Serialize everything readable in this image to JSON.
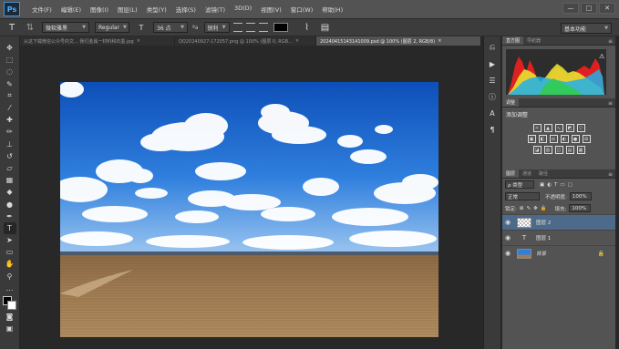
{
  "app": {
    "logo": "Ps"
  },
  "menu": [
    "文件(F)",
    "编辑(E)",
    "图像(I)",
    "图层(L)",
    "类型(Y)",
    "选择(S)",
    "滤镜(T)",
    "3D(D)",
    "视图(V)",
    "窗口(W)",
    "帮助(H)"
  ],
  "window_controls": {
    "minimize": "—",
    "maximize": "□",
    "close": "✕"
  },
  "options": {
    "font_family": "微软雅黑",
    "font_style": "Regular",
    "font_size": "36 点",
    "aa_prefix": "ªa",
    "antialias": "锐利",
    "workspace": "基本功能"
  },
  "doc_tabs": [
    {
      "label": "从这下载微信公众号的文... 我们金属一材料和石墨.jpg",
      "close": "×"
    },
    {
      "label": "QQ20240927-172057.png @ 100% (图层 0, RGB...",
      "close": "×"
    },
    {
      "label": "20240415143141009.psd @ 100% (图层 2, RGB/8)",
      "close": "×"
    }
  ],
  "panels": {
    "histogram_tabs": [
      "直方图",
      "导航器"
    ],
    "adjust_tab": "调整",
    "adjust_title": "添加调整",
    "layers_tabs": [
      "图层",
      "通道",
      "路径"
    ],
    "kind_filter": "ρ 类型",
    "blend_mode": "正常",
    "opacity_label": "不透明度:",
    "opacity_value": "100%",
    "lock_label": "锁定:",
    "fill_label": "填充:",
    "fill_value": "100%",
    "layers": [
      {
        "name": "图层 2",
        "selected": true,
        "type": "image"
      },
      {
        "name": "图层 1",
        "selected": false,
        "type": "text"
      },
      {
        "name": "背景",
        "selected": false,
        "type": "background"
      }
    ]
  }
}
